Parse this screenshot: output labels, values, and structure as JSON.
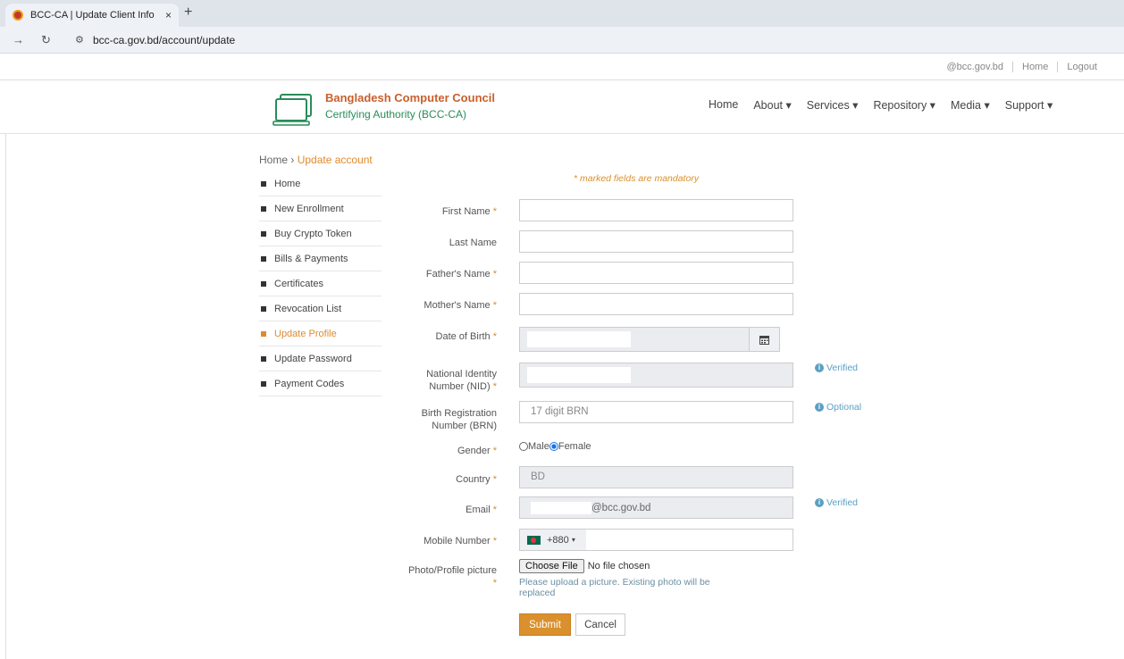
{
  "browser": {
    "tab_title": "BCC-CA | Update Client Info",
    "tab_close": "×",
    "new_tab": "+",
    "url": "bcc-ca.gov.bd/account/update"
  },
  "top_links": [
    "@bcc.gov.bd",
    "Home",
    "Logout"
  ],
  "brand": {
    "name": "Bangladesh Computer Council",
    "subtitle": "Certifying Authority (BCC-CA)"
  },
  "main_nav": [
    "Home",
    "About ▾",
    "Services ▾",
    "Repository ▾",
    "Media ▾",
    "Support ▾"
  ],
  "breadcrumb": {
    "home": "Home",
    "sep": "›",
    "current": "Update account"
  },
  "side_nav": {
    "items": [
      "Home",
      "New Enrollment",
      "Buy Crypto Token",
      "Bills & Payments",
      "Certificates",
      "Revocation List",
      "Update Profile",
      "Update Password",
      "Payment Codes"
    ],
    "active": "Update Profile"
  },
  "form": {
    "mandatory_note": "* marked fields are mandatory",
    "star": "*",
    "labels": {
      "first_name": "First Name",
      "last_name": "Last Name",
      "father_name": "Father's Name",
      "mother_name": "Mother's Name",
      "dob": "Date of Birth",
      "nid_line1": "National Identity",
      "nid_line2": "Number (NID)",
      "brn_line1": "Birth Registration",
      "brn_line2": "Number (BRN)",
      "gender": "Gender",
      "country": "Country",
      "email": "Email",
      "mobile": "Mobile Number",
      "photo": "Photo/Profile picture"
    },
    "brn_placeholder": "17 digit BRN",
    "nid_note": "Verified",
    "brn_note": "Optional",
    "email_note": "Verified",
    "gender_male": "Male",
    "gender_female": "Female",
    "gender_selected": "Female",
    "country_value": "BD",
    "email_domain": "@bcc.gov.bd",
    "dial_code": "+880",
    "dial_caret": "▾",
    "choose_file": "Choose File",
    "no_file": "No file chosen",
    "photo_hint": "Please upload a picture. Existing photo will be replaced",
    "submit": "Submit",
    "cancel": "Cancel"
  }
}
